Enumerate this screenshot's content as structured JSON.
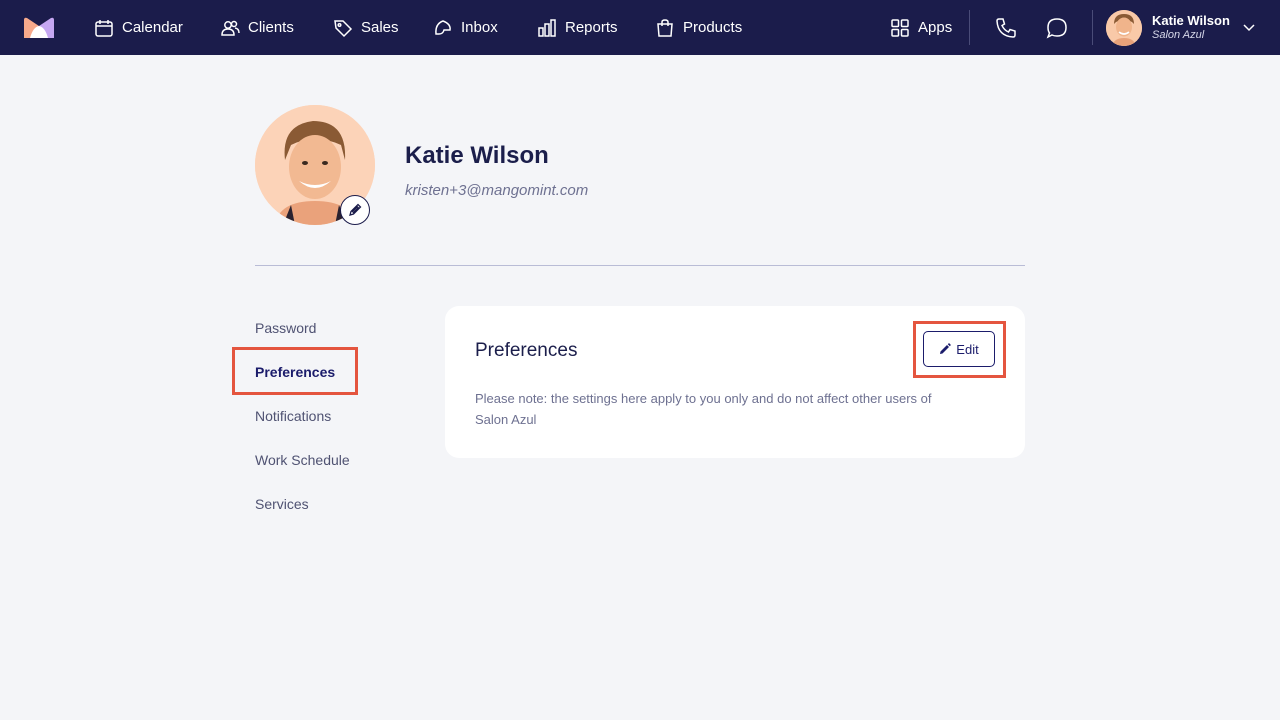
{
  "nav": {
    "items": [
      {
        "label": "Calendar",
        "icon": "calendar-icon"
      },
      {
        "label": "Clients",
        "icon": "users-icon"
      },
      {
        "label": "Sales",
        "icon": "tag-icon"
      },
      {
        "label": "Inbox",
        "icon": "inbox-icon"
      },
      {
        "label": "Reports",
        "icon": "bar-chart-icon"
      },
      {
        "label": "Products",
        "icon": "shopping-bag-icon"
      }
    ],
    "apps_label": "Apps",
    "user": {
      "name": "Katie Wilson",
      "org": "Salon Azul"
    }
  },
  "profile": {
    "name": "Katie Wilson",
    "email": "kristen+3@mangomint.com"
  },
  "side_menu": {
    "items": [
      "Password",
      "Preferences",
      "Notifications",
      "Work Schedule",
      "Services"
    ],
    "active": "Preferences"
  },
  "card": {
    "title": "Preferences",
    "edit_label": "Edit",
    "note": "Please note: the settings here apply to you only and do not affect other users of Salon Azul"
  },
  "colors": {
    "nav_bg": "#1b1c4b",
    "page_bg": "#f4f5f8",
    "highlight": "#e4553f",
    "accent": "#1b1c6b"
  }
}
